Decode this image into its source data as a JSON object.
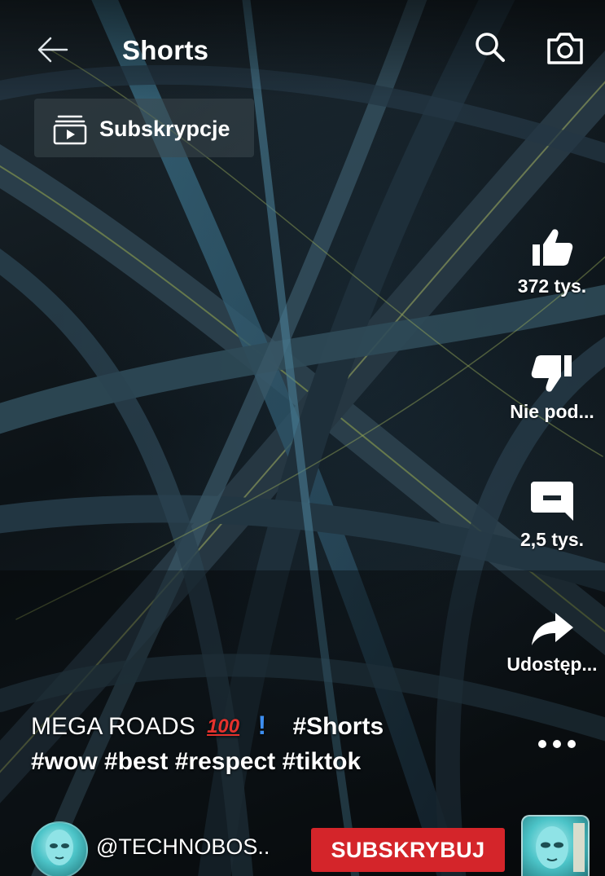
{
  "header": {
    "title": "Shorts",
    "back_icon": "arrow-left-icon",
    "search_icon": "search-icon",
    "camera_icon": "camera-icon"
  },
  "subscriptions_chip": {
    "label": "Subskrypcje",
    "icon": "subscriptions-icon"
  },
  "actions": {
    "like": {
      "icon": "thumbs-up-icon",
      "label": "372 tys."
    },
    "dislike": {
      "icon": "thumbs-down-icon",
      "label": "Nie pod..."
    },
    "comments": {
      "icon": "comment-icon",
      "label": "2,5 tys."
    },
    "share": {
      "icon": "share-icon",
      "label": "Udostęp..."
    },
    "more": {
      "icon": "more-icon"
    }
  },
  "caption": {
    "title_text": "MEGA ROADS",
    "emoji_100": "100",
    "exclamation": "!",
    "hashtag_shorts": "#Shorts",
    "hashtags_line2": "#wow #best #respect #tiktok"
  },
  "channel": {
    "name": "@TECHNOBOS..",
    "subscribe_label": "SUBSKRYBUJ"
  },
  "colors": {
    "subscribe_red": "#d4252a",
    "text": "#ffffff",
    "exclamation_blue": "#3d8ef0"
  }
}
